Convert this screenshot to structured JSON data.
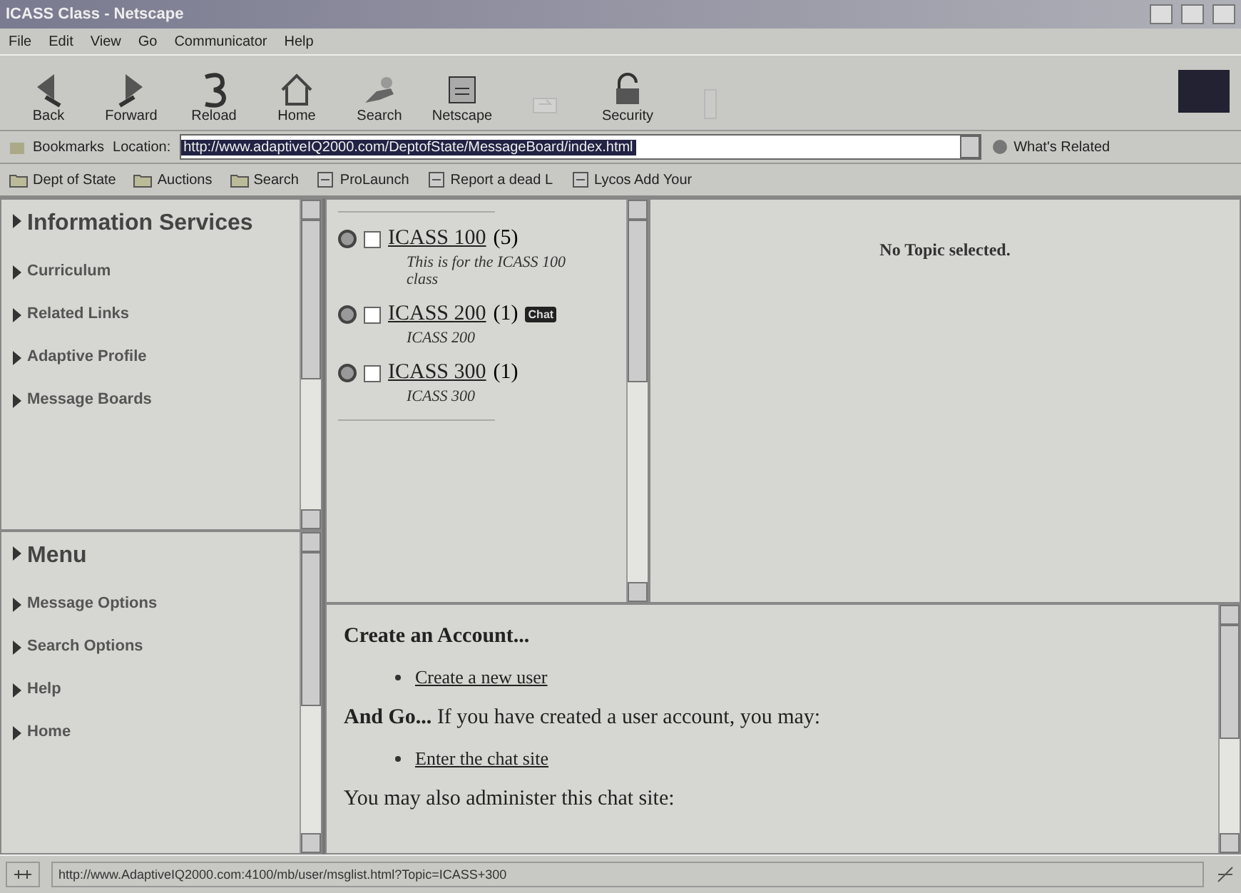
{
  "window": {
    "title": "ICASS Class - Netscape"
  },
  "menu": [
    "File",
    "Edit",
    "View",
    "Go",
    "Communicator",
    "Help"
  ],
  "toolbar": [
    {
      "kind": "back",
      "label": "Back",
      "disabled": false
    },
    {
      "kind": "forward",
      "label": "Forward",
      "disabled": false
    },
    {
      "kind": "reload",
      "label": "Reload",
      "disabled": false
    },
    {
      "kind": "home",
      "label": "Home",
      "disabled": false
    },
    {
      "kind": "search",
      "label": "Search",
      "disabled": false
    },
    {
      "kind": "netscape",
      "label": "Netscape",
      "disabled": false
    },
    {
      "kind": "print",
      "disabled": true
    },
    {
      "kind": "security",
      "label": "Security",
      "disabled": false
    },
    {
      "kind": "stop",
      "disabled": true
    }
  ],
  "location_bar": {
    "bookmarks": "Bookmarks",
    "location_label": "Location:",
    "url": "http://www.adaptiveIQ2000.com/DeptofState/MessageBoard/index.html",
    "whats_related": "What's Related"
  },
  "personal_toolbar": [
    {
      "kind": "folder",
      "label": "Dept of State"
    },
    {
      "kind": "folder",
      "label": "Auctions"
    },
    {
      "kind": "folder",
      "label": "Search"
    },
    {
      "kind": "link",
      "label": "ProLaunch"
    },
    {
      "kind": "link",
      "label": "Report a dead L"
    },
    {
      "kind": "link",
      "label": "Lycos Add Your"
    }
  ],
  "nav_top": {
    "heading": "Information Services",
    "items": [
      "Curriculum",
      "Related Links",
      "Adaptive Profile",
      "Message Boards"
    ]
  },
  "nav_bottom": {
    "heading": "Menu",
    "items": [
      "Message Options",
      "Search Options",
      "Help",
      "Home"
    ]
  },
  "topics": [
    {
      "title": "ICASS 100",
      "count": "(5)",
      "checked": false,
      "description": "This is for the ICASS 100 class"
    },
    {
      "title": "ICASS 200",
      "count": "(1)",
      "checked": false,
      "badge": "Chat",
      "description": "ICASS 200"
    },
    {
      "title": "ICASS 300",
      "count": "(1)",
      "checked": false,
      "description": "ICASS 300"
    }
  ],
  "topic_view": {
    "message": "No Topic selected."
  },
  "content": [
    {
      "kind": "heading",
      "text": "Create an Account..."
    },
    {
      "kind": "link",
      "text": "Create a new user"
    },
    {
      "kind": "paragraph",
      "text": "**And Go...** If you have created a user account, you may:"
    },
    {
      "kind": "link",
      "text": "Enter the chat site"
    },
    {
      "kind": "paragraph",
      "text": "You may also administer this chat site:"
    }
  ],
  "status_bar": {
    "url": "http://www.AdaptiveIQ2000.com:4100/mb/user/msglist.html?Topic=ICASS+300"
  }
}
